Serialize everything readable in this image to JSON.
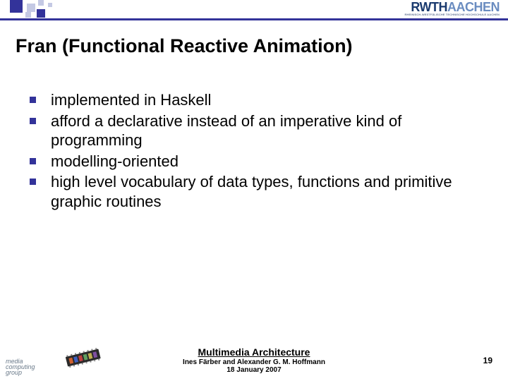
{
  "header": {
    "institution_logo_main": "RWTH",
    "institution_logo_sub": "AACHEN",
    "institution_logo_tagline": "RHEINISCH-WESTFÄLISCHE TECHNISCHE HOCHSCHULE AACHEN"
  },
  "title": "Fran (Functional Reactive Animation)",
  "bullets": [
    "implemented in Haskell",
    "afford a declarative instead of an imperative kind of programming",
    "modelling-oriented",
    "high level vocabulary of data types, functions and primitive graphic routines"
  ],
  "footer": {
    "course": "Multimedia Architecture",
    "authors": "Ines Färber and Alexander G. M. Hoffmann",
    "date": "18 January 2007"
  },
  "page_number": "19",
  "media_logo": {
    "line1": "media",
    "line2": "computing",
    "line3": "group"
  }
}
